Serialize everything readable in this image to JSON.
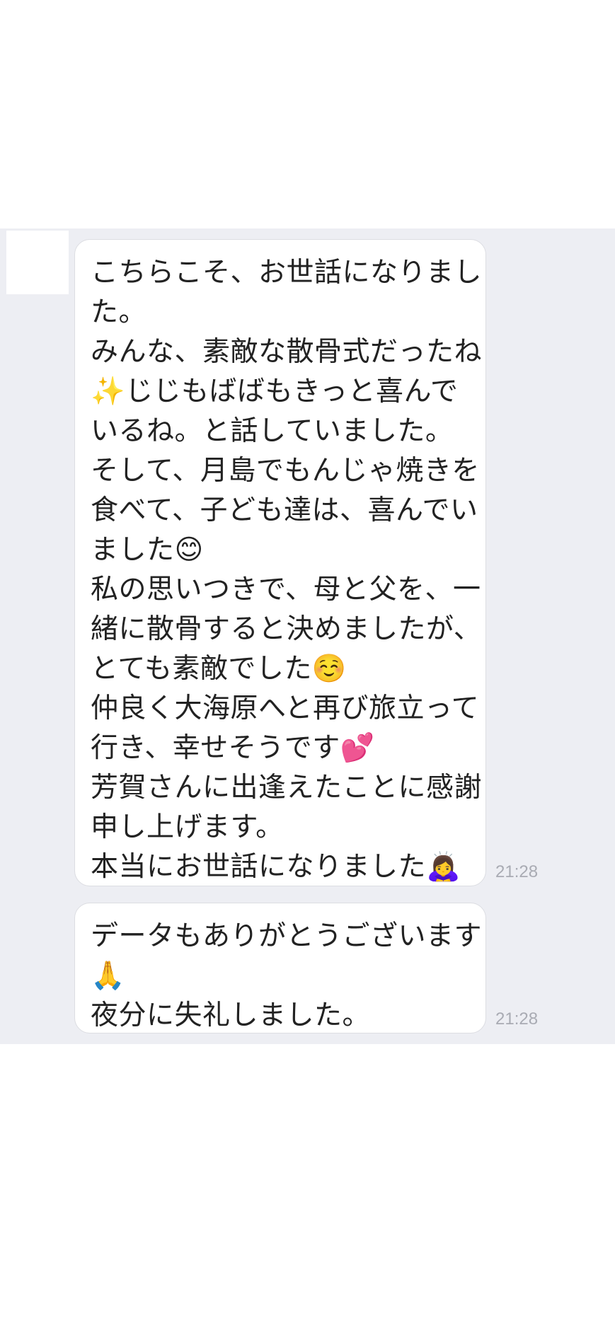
{
  "messages": [
    {
      "lines": [
        "こちらこそ、お世話になりまし",
        "た。",
        "みんな、素敵な散骨式だったね",
        "✨じじもばばもきっと喜んで",
        "いるね。と話していました。",
        "そして、月島でもんじゃ焼きを",
        "食べて、子ども達は、喜んでい",
        "ました😊",
        "私の思いつきで、母と父を、一",
        "緒に散骨すると決めましたが、",
        "とても素敵でした☺️",
        "仲良く大海原へと再び旅立って",
        "行き、幸せそうです💕",
        "芳賀さんに出逢えたことに感謝",
        "申し上げます。",
        "本当にお世話になりました🙇‍♀️"
      ],
      "time": "21:28"
    },
    {
      "lines": [
        "データもありがとうございます",
        "🙏",
        "夜分に失礼しました。"
      ],
      "time": "21:28"
    }
  ],
  "colors": {
    "chat_background": "#edeef3",
    "bubble_background": "#ffffff",
    "text": "#222222",
    "timestamp": "#a9abb3"
  }
}
